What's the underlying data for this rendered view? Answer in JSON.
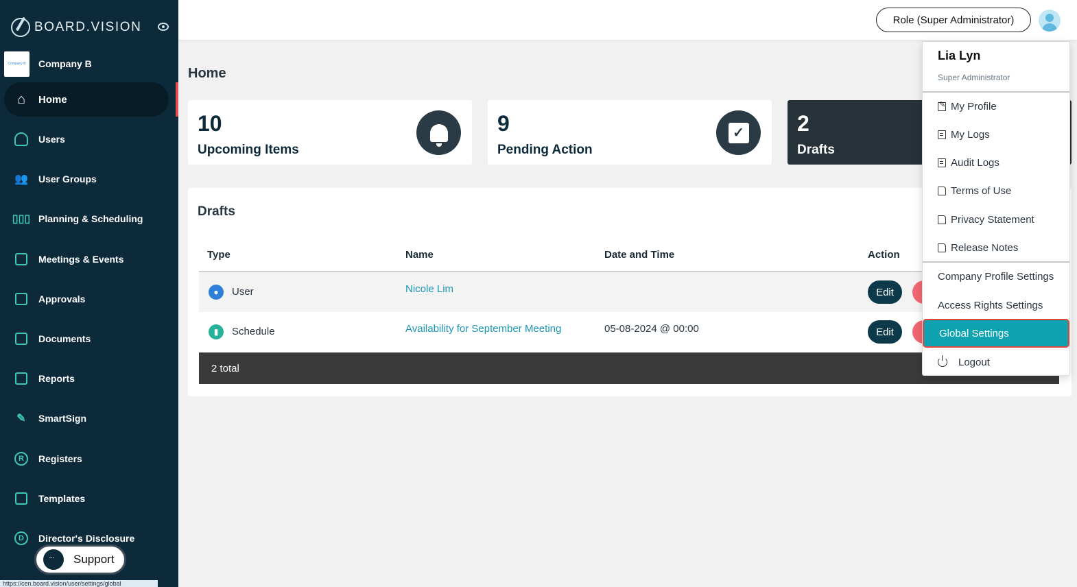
{
  "brand": {
    "logo_text": "BOARD.VISION"
  },
  "company": {
    "name": "Company B",
    "logo_text": "Company B"
  },
  "sidebar": {
    "items": [
      {
        "label": "Home",
        "icon": "home-icon"
      },
      {
        "label": "Users",
        "icon": "user-icon"
      },
      {
        "label": "User Groups",
        "icon": "user-groups-icon"
      },
      {
        "label": "Planning & Scheduling",
        "icon": "bar-chart-icon"
      },
      {
        "label": "Meetings & Events",
        "icon": "calendar-check-icon"
      },
      {
        "label": "Approvals",
        "icon": "approvals-icon"
      },
      {
        "label": "Documents",
        "icon": "documents-icon"
      },
      {
        "label": "Reports",
        "icon": "reports-icon"
      },
      {
        "label": "SmartSign",
        "icon": "pen-icon"
      },
      {
        "label": "Registers",
        "icon": "registered-icon"
      },
      {
        "label": "Templates",
        "icon": "template-icon"
      },
      {
        "label": "Director's Disclosure",
        "icon": "disclosure-icon"
      }
    ],
    "support_label": "Support",
    "status_url": "https://cen.board.vision/user/settings/global"
  },
  "topbar": {
    "role_label": "Role (Super Administrator)"
  },
  "page": {
    "title": "Home"
  },
  "stats": [
    {
      "value": "10",
      "label": "Upcoming Items",
      "icon": "bell-icon"
    },
    {
      "value": "9",
      "label": "Pending Action",
      "icon": "checkbox-icon"
    },
    {
      "value": "2",
      "label": "Drafts",
      "icon": "drafts-icon"
    }
  ],
  "drafts": {
    "title": "Drafts",
    "columns": [
      "Type",
      "Name",
      "Date and Time",
      "Action"
    ],
    "rows": [
      {
        "type": "User",
        "name": "Nicole Lim",
        "datetime": "",
        "edit": "Edit"
      },
      {
        "type": "Schedule",
        "name": "Availability for September Meeting",
        "datetime": "05-08-2024 @ 00:00",
        "edit": "Edit"
      }
    ],
    "total": "2 total"
  },
  "menu": {
    "user_name": "Lia Lyn",
    "user_role": "Super Administrator",
    "items": [
      "My Profile",
      "My Logs",
      "Audit Logs",
      "Terms of Use",
      "Privacy Statement",
      "Release Notes"
    ],
    "settings": [
      "Company Profile Settings",
      "Access Rights Settings",
      "Global Settings"
    ],
    "logout": "Logout"
  },
  "colors": {
    "sidebar": "#0c2a3a",
    "accent": "#0fa3b1",
    "link": "#1997b4",
    "danger": "#f06672"
  }
}
